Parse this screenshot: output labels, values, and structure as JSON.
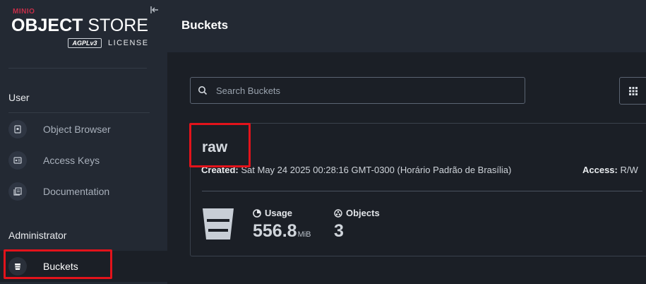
{
  "brand": {
    "minio": "MINIO",
    "title_bold": "OBJECT",
    "title_rest": " STORE",
    "agpl": "AGPLv3",
    "license": "LICENSE"
  },
  "sidebar": {
    "sections": [
      {
        "title": "User"
      },
      {
        "title": "Administrator"
      }
    ],
    "items": [
      {
        "label": "Object Browser",
        "icon": "object-browser-icon"
      },
      {
        "label": "Access Keys",
        "icon": "access-keys-icon"
      },
      {
        "label": "Documentation",
        "icon": "documentation-icon"
      },
      {
        "label": "Buckets",
        "icon": "bucket-icon",
        "active": true
      }
    ]
  },
  "header": {
    "title": "Buckets"
  },
  "search": {
    "placeholder": "Search Buckets",
    "value": ""
  },
  "bucket": {
    "name": "raw",
    "created_label": "Created:",
    "created_value": " Sat May 24 2025 00:28:16 GMT-0300 (Horário Padrão de Brasília)",
    "access_label": "Access:",
    "access_value": " R/W",
    "usage_label": "Usage",
    "usage_value": "556.8",
    "usage_unit": "MiB",
    "objects_label": "Objects",
    "objects_value": "3"
  },
  "colors": {
    "sidebar_bg": "#232933",
    "main_bg": "#1b1f26",
    "brand_red": "#c72e49",
    "highlight": "#e3131b"
  }
}
